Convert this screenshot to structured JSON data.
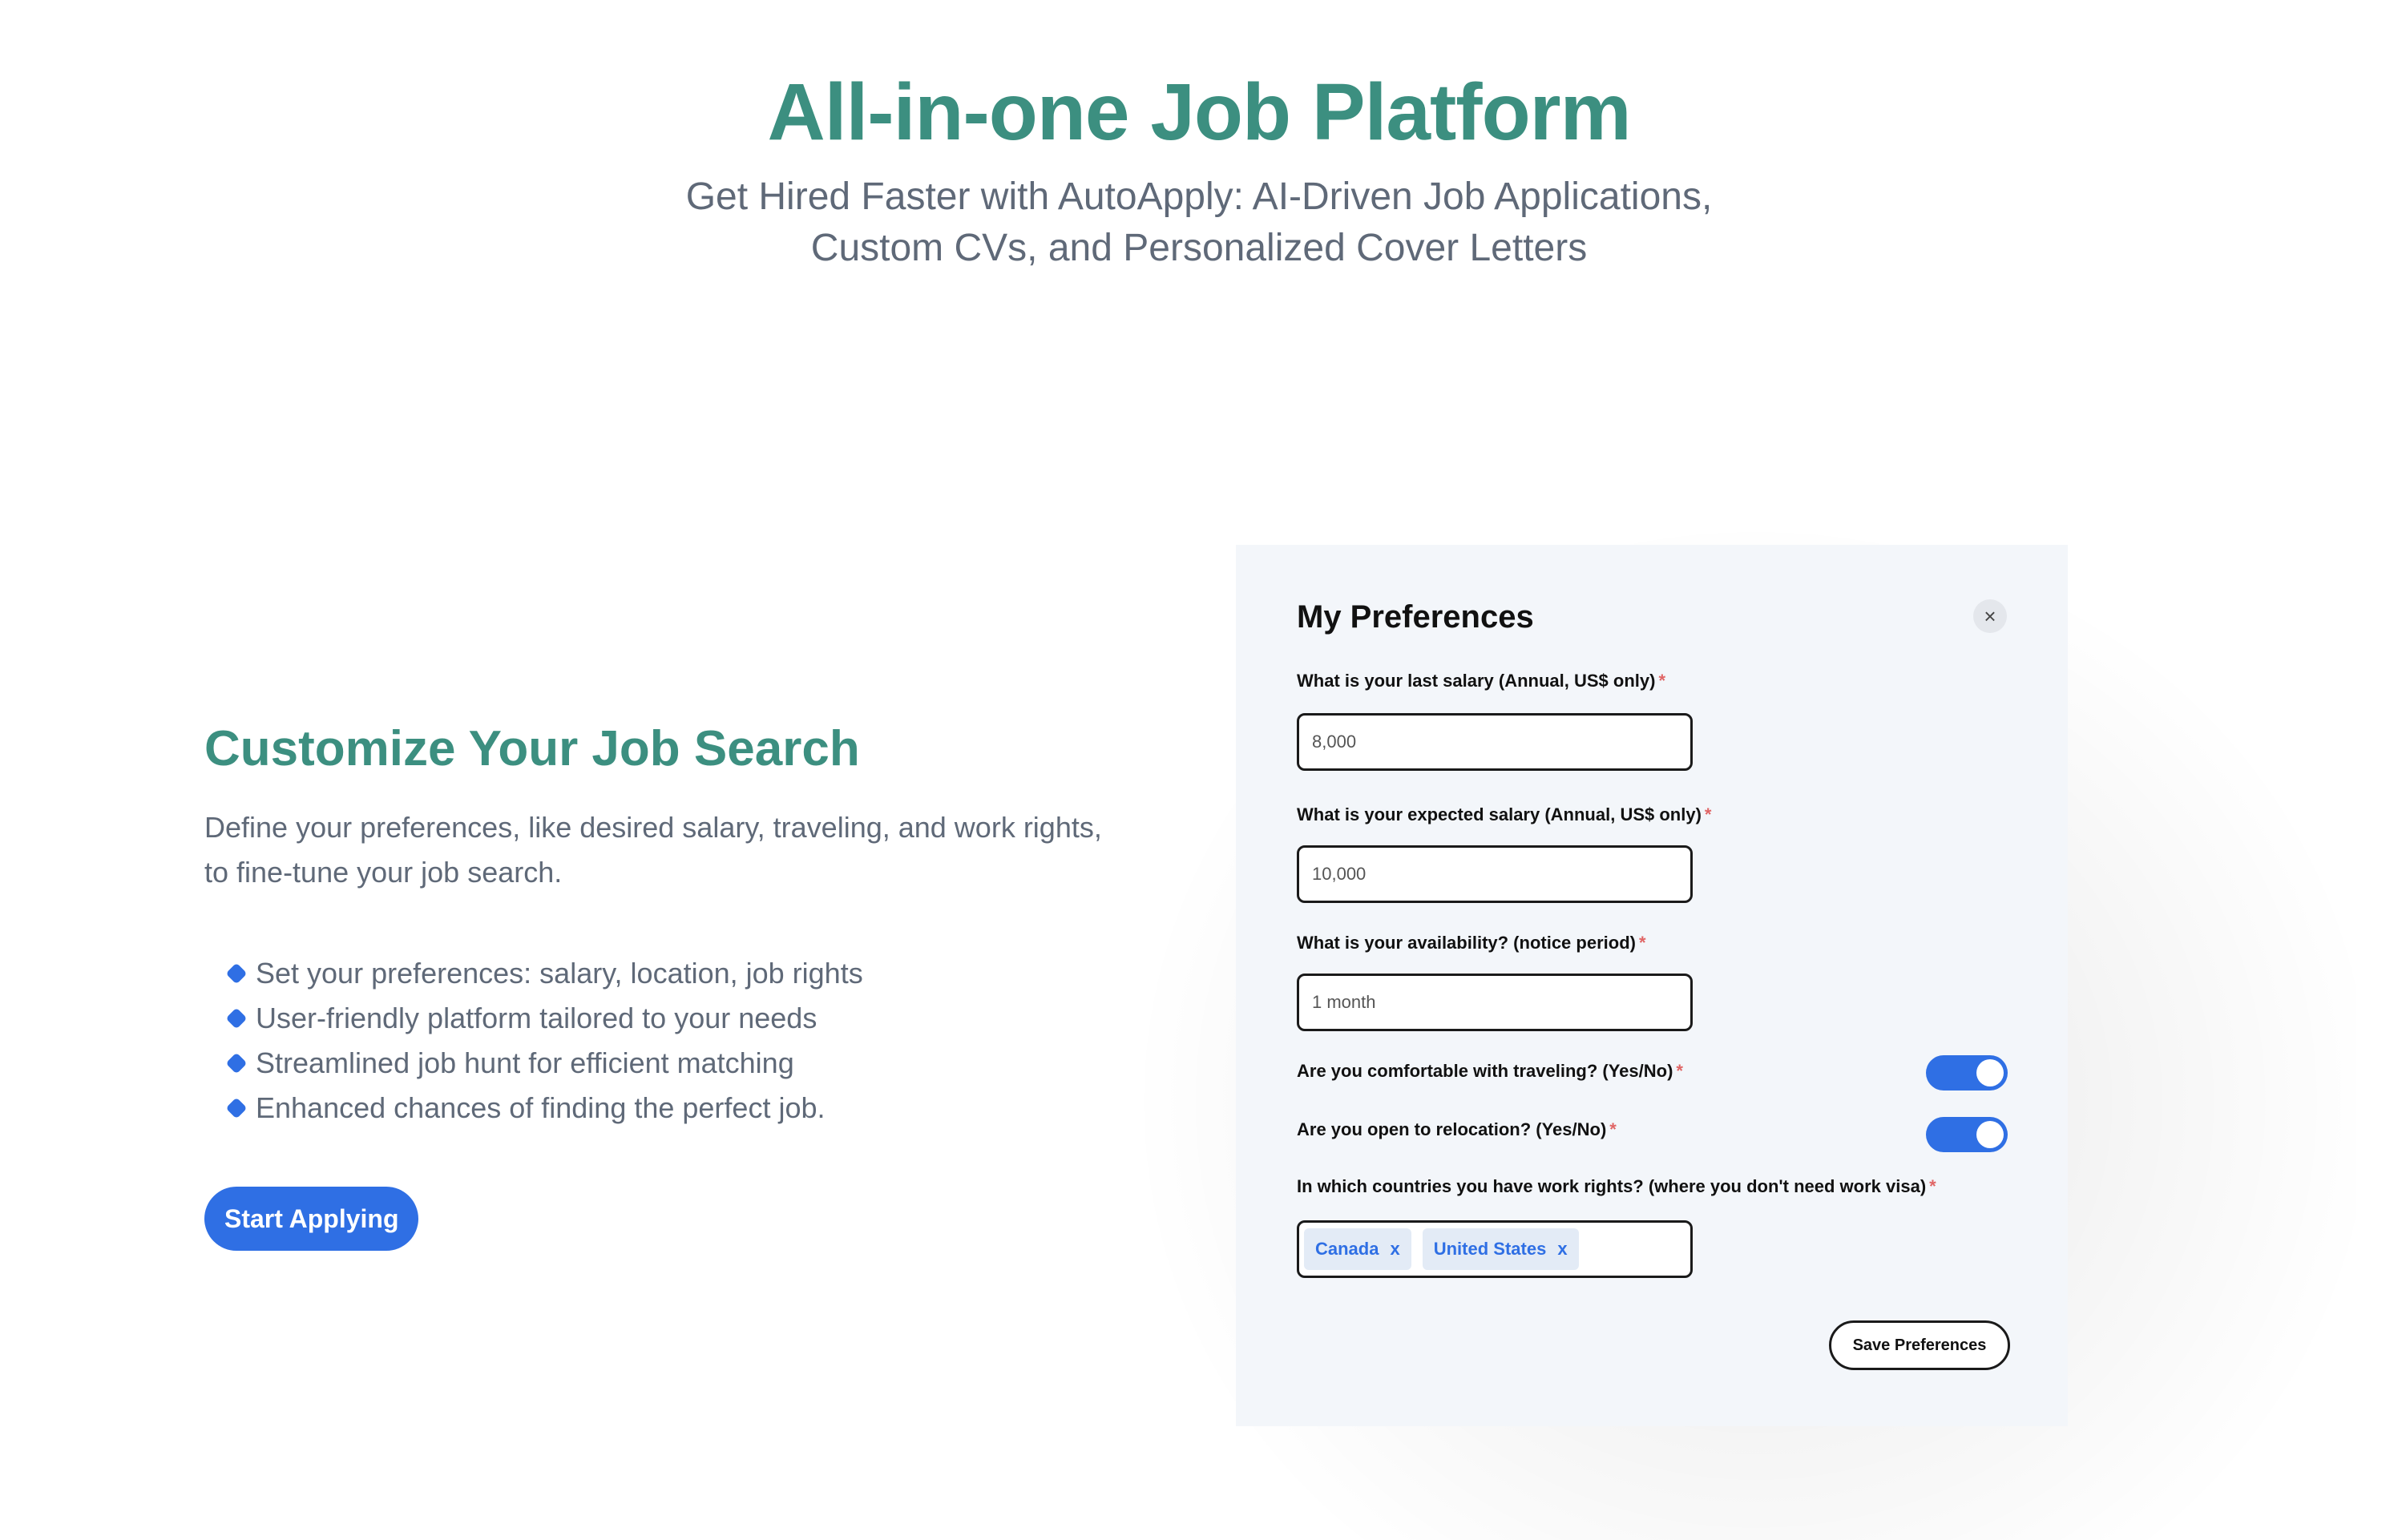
{
  "hero": {
    "title": "All-in-one Job Platform",
    "subtitle": "Get Hired Faster with AutoApply: AI-Driven Job Applications, Custom CVs, and Personalized Cover Letters"
  },
  "left": {
    "title": "Customize Your Job Search",
    "description": "Define your preferences, like desired salary, traveling, and work rights, to fine-tune your job search.",
    "features": [
      "Set your preferences: salary, location, job rights",
      "User-friendly platform tailored to your needs",
      "Streamlined job hunt for efficient matching",
      "Enhanced chances of finding the perfect job."
    ],
    "cta_label": "Start Applying"
  },
  "card": {
    "title": "My Preferences",
    "close_symbol": "×",
    "required_mark": "*",
    "fields": [
      {
        "label": "What is your last salary (Annual, US$ only)",
        "value": "8,000"
      },
      {
        "label": "What is your expected salary (Annual, US$ only)",
        "value": "10,000"
      },
      {
        "label": "What is your availability? (notice period)",
        "value": "1 month"
      }
    ],
    "toggles": [
      {
        "label": "Are you comfortable with traveling? (Yes/No)",
        "on": true
      },
      {
        "label": "Are you open to relocation? (Yes/No)",
        "on": true
      }
    ],
    "work_rights": {
      "label": "In which countries you have work rights? (where you don't need work visa)",
      "tags": [
        "Canada",
        "United States"
      ],
      "remove_symbol": "x"
    },
    "save_label": "Save Preferences"
  },
  "colors": {
    "heading": "#3c8f80",
    "accent": "#2f6fe4",
    "body_text": "#5f6978",
    "required": "#e06565",
    "card_bg": "#f3f6fa"
  },
  "icons": [
    "bullet-icon",
    "close-icon",
    "tag-remove-icon"
  ]
}
